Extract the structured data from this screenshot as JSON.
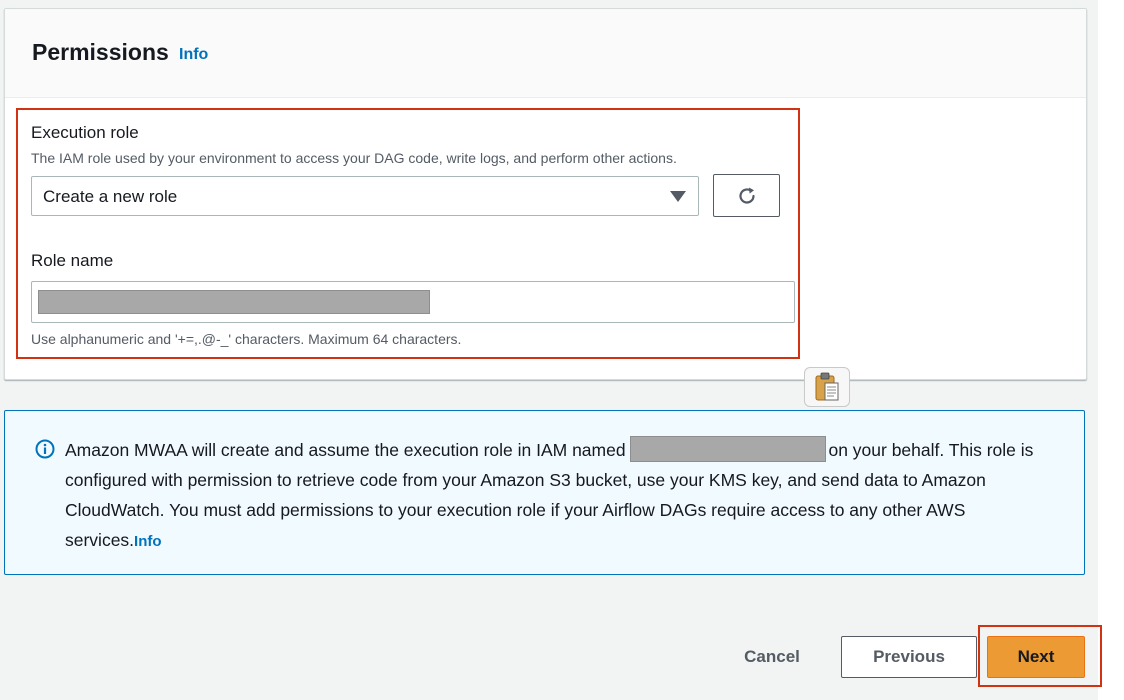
{
  "section": {
    "title": "Permissions",
    "info_link": "Info"
  },
  "execution_role": {
    "label": "Execution role",
    "description": "The IAM role used by your environment to access your DAG code, write logs, and perform other actions.",
    "selected_value": "Create a new role",
    "refresh_icon": "refresh-icon"
  },
  "role_name": {
    "label": "Role name",
    "value": "",
    "constraint": "Use alphanumeric and '+=,.@-_' characters. Maximum 64 characters."
  },
  "alert": {
    "icon": "info-circle-icon",
    "text_before": "Amazon MWAA will create and assume the execution role in IAM named",
    "text_after": "on your behalf. This role is configured with permission to retrieve code from your Amazon S3 bucket, use your KMS key, and send data to Amazon CloudWatch. You must add permissions to your execution role if your Airflow DAGs require access to any other AWS services.",
    "info_link": "Info"
  },
  "footer": {
    "cancel_label": "Cancel",
    "previous_label": "Previous",
    "next_label": "Next"
  },
  "colors": {
    "accent": "#0073bb",
    "primary_button": "#ec9a33",
    "highlight": "#d13212"
  }
}
